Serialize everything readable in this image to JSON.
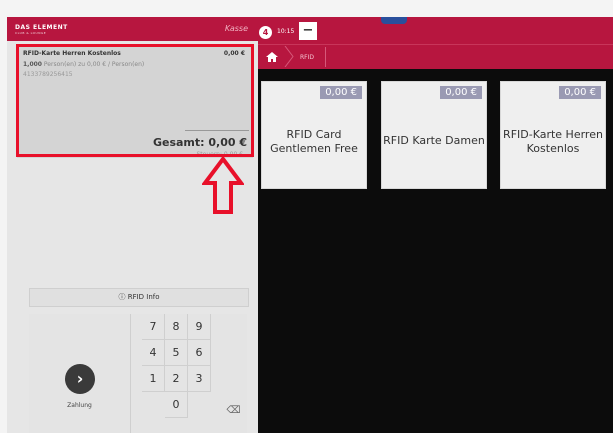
{
  "left_header": {
    "logo": "DAS ELEMENT",
    "logo_sub": "CLUB & LOUNGE",
    "title": "Kasse"
  },
  "receipt": {
    "item_name": "RFID-Karte Herren Kostenlos",
    "item_price": "0,00 €",
    "quantity": "1,000",
    "detail": "Person(en) zu 0,00 € / Person(en)",
    "barcode": "4133789256415",
    "total": "Gesamt: 0,00 €",
    "tax": "Steuern: 0,00 €"
  },
  "rfid_info": {
    "label": "RFID Info"
  },
  "numpad": {
    "pay_label": "Zahlung",
    "keys": [
      "7",
      "8",
      "9",
      "4",
      "5",
      "6",
      "1",
      "2",
      "3",
      "0",
      "⌫"
    ]
  },
  "top_bar": {
    "badge": "4",
    "time": "10:15",
    "minus_label": "−"
  },
  "breadcrumb": {
    "current": "RFID"
  },
  "tiles": [
    {
      "price": "0,00 €",
      "name": "RFID Card Gentlemen Free"
    },
    {
      "price": "0,00 €",
      "name": "RFID Karte Damen"
    },
    {
      "price": "0,00 €",
      "name": "RFID-Karte Herren Kostenlos"
    }
  ],
  "colors": {
    "brand": "#b7163f",
    "highlight": "#e8102a",
    "price_badge": "#9a9ab3"
  }
}
